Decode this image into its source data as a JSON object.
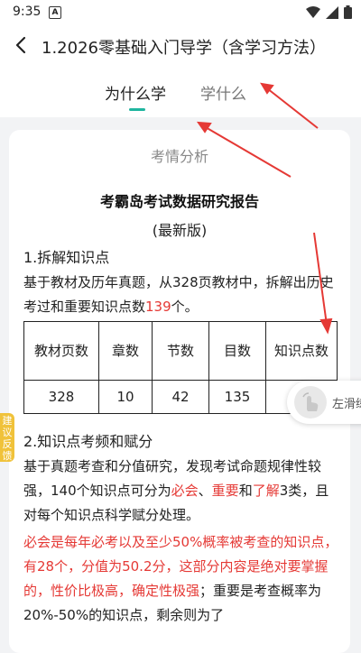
{
  "status": {
    "time": "9:35",
    "notification_icon": "A"
  },
  "header": {
    "title": "1.2026零基础入门导学（含学习方法）"
  },
  "tabs": [
    {
      "label": "为什么学",
      "active": true
    },
    {
      "label": "学什么",
      "active": false
    }
  ],
  "card": {
    "heading": "考情分析",
    "report_title": "考霸岛考试数据研究报告",
    "report_subtitle": "(最新版)",
    "section1_title": "1.拆解知识点",
    "para1_text": "基于教材及历年真题，从328页教材中，拆解出历史考过和重要知识点数",
    "para1_red": "139",
    "para1_end": "个。",
    "table": {
      "headers": [
        "教材页数",
        "章数",
        "节数",
        "目数",
        "知识点数"
      ],
      "row": [
        "328",
        "10",
        "42",
        "135",
        ""
      ]
    },
    "section2_title": "2.知识点考频和赋分",
    "para2_start": "基于真题考查和分值研究，发现考试命题规律性较强，140个知识点可分为",
    "para2_red1": "必会",
    "para2_sep1": "、",
    "para2_red2": "重要",
    "para2_sep2": "和",
    "para2_red3": "了解",
    "para2_end": "3类，且对每个知识点科学赋分处理。",
    "para3_red": "必会是每年必考以及至少50%概率被考查的知识点，有28个，分值为50.2分，这部分内容是绝对要掌握的，性价比极高，确定性极强",
    "para3_end": "；重要是考查概率为20%-50%的知识点，剩余则为了"
  },
  "feedback_tab": "建议反馈",
  "swipe_hint": "左滑练",
  "colors": {
    "accent": "#1fb59f",
    "highlight": "#e53935",
    "annotation_arrow": "#e53935",
    "feedback": "#f0c23a"
  }
}
